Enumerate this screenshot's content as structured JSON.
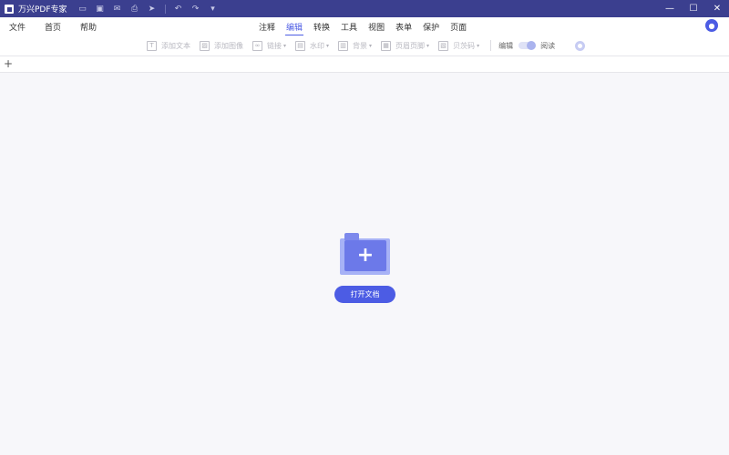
{
  "app": {
    "title": "万兴PDF专家"
  },
  "quick_access": [
    {
      "name": "open-folder-icon",
      "glyph": "▭"
    },
    {
      "name": "save-icon",
      "glyph": "▣"
    },
    {
      "name": "mail-icon",
      "glyph": "✉"
    },
    {
      "name": "print-icon",
      "glyph": "⎙"
    },
    {
      "name": "share-icon",
      "glyph": "➤"
    },
    {
      "name": "undo-icon",
      "glyph": "↶"
    },
    {
      "name": "redo-icon",
      "glyph": "↷"
    },
    {
      "name": "customize-icon",
      "glyph": "▾"
    }
  ],
  "window_controls": {
    "minimize": "—",
    "maximize": "☐",
    "close": "✕"
  },
  "menu_left": [
    "文件",
    "首页",
    "帮助"
  ],
  "menu_tabs": [
    "注释",
    "编辑",
    "转换",
    "工具",
    "视图",
    "表单",
    "保护",
    "页面"
  ],
  "active_tab": "编辑",
  "toolbar": {
    "tools": [
      {
        "label": "添加文本",
        "icon": "T",
        "has_caret": false
      },
      {
        "label": "添加图像",
        "icon": "▨",
        "has_caret": false
      },
      {
        "label": "链接",
        "icon": "∞",
        "has_caret": true
      },
      {
        "label": "水印",
        "icon": "▤",
        "has_caret": true
      },
      {
        "label": "背景",
        "icon": "▥",
        "has_caret": true
      },
      {
        "label": "页眉页脚",
        "icon": "▦",
        "has_caret": true
      },
      {
        "label": "贝茨码",
        "icon": "▧",
        "has_caret": true
      }
    ],
    "mode_edit": "编辑",
    "mode_read": "阅读"
  },
  "tabstrip": {
    "new_tab": "+"
  },
  "empty_state": {
    "button_label": "打开文档"
  },
  "colors": {
    "title_bar": "#3b3f8f",
    "accent": "#4c5ce4",
    "folder_light": "#a7b2f6",
    "folder_dark": "#6c79e9"
  }
}
